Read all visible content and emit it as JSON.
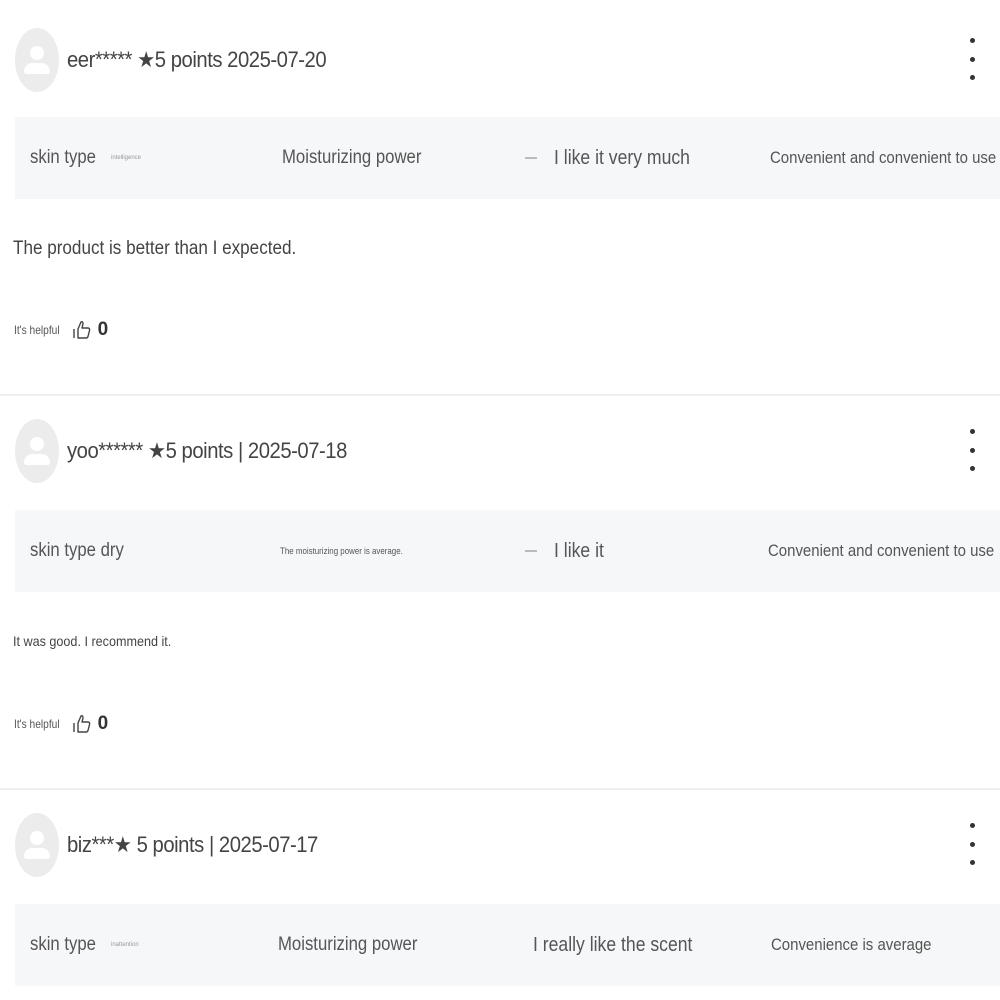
{
  "colors": {
    "divider": "#eeeeee",
    "attr_bg": "#f6f7f9",
    "avatar_bg": "#ececec"
  },
  "icons": {
    "avatar": "person-icon",
    "more": "more-vertical-icon",
    "helpful": "thumbs-up-icon"
  },
  "reviews": [
    {
      "meta": "eer***** ★5 points 2025-07-20",
      "attrs": {
        "skin_label": "skin type",
        "skin_value": "intelligence",
        "moisture": "Moisturizing power",
        "liking": "I like it very much",
        "convenience": "Convenient and convenient to use"
      },
      "comment": "The product is better than I expected.",
      "helpful_label": "It's helpful",
      "helpful_count": "0"
    },
    {
      "meta": "yoo****** ★5 points | 2025-07-18",
      "attrs": {
        "skin_label": "skin type dry",
        "moisture": "The moisturizing power is average.",
        "liking": "I like it",
        "convenience": "Convenient and convenient to use"
      },
      "comment": "It was good. I recommend it.",
      "helpful_label": "It's helpful",
      "helpful_count": "0"
    },
    {
      "meta": "biz***★ 5 points | 2025-07-17",
      "attrs": {
        "skin_label": "skin type",
        "skin_value": "inattention",
        "moisture": "Moisturizing power",
        "liking": "I really like the scent",
        "convenience": "Convenience is average"
      }
    }
  ]
}
